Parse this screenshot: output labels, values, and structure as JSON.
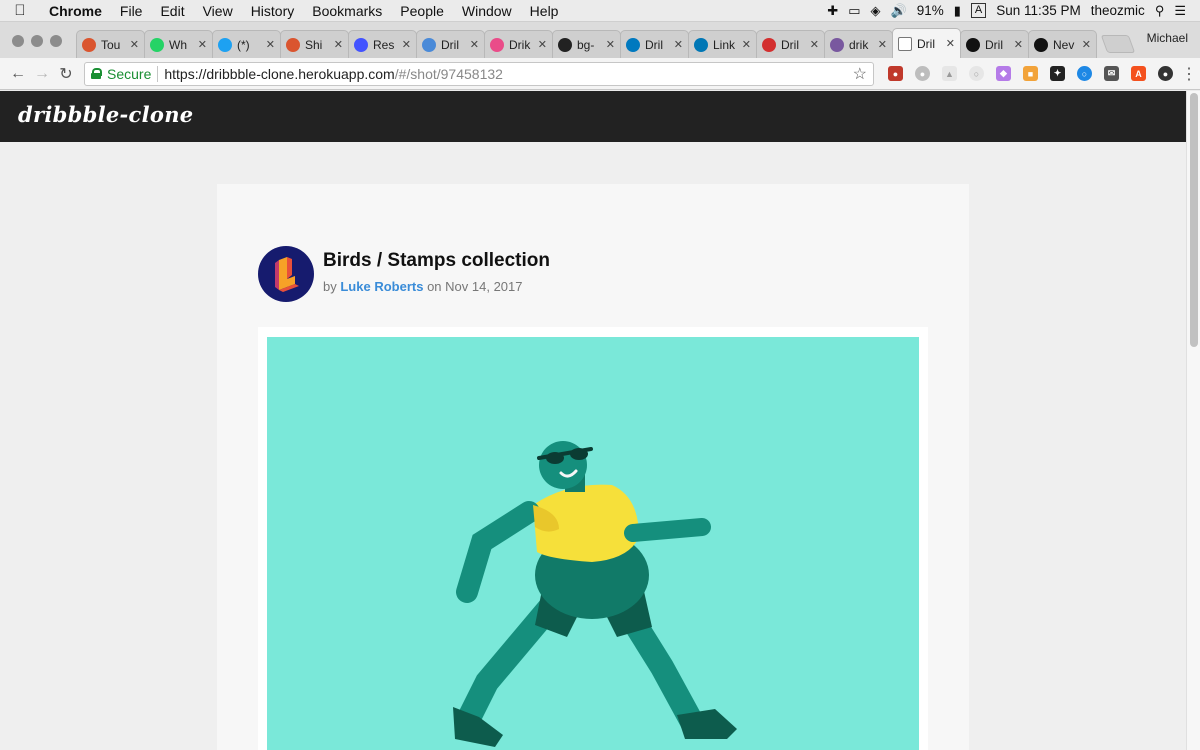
{
  "menubar": {
    "app": "Chrome",
    "items": [
      "File",
      "Edit",
      "View",
      "History",
      "Bookmarks",
      "People",
      "Window",
      "Help"
    ],
    "battery": "91%",
    "input_source": "A",
    "clock": "Sun 11:35 PM",
    "user": "theozmic"
  },
  "tabs": [
    {
      "label": "Tou",
      "icon": "product-hunt-icon",
      "color": "#da552f"
    },
    {
      "label": "Wh",
      "icon": "whatsapp-icon",
      "color": "#25d366"
    },
    {
      "label": "(*)",
      "icon": "twitter-icon",
      "color": "#1da1f2"
    },
    {
      "label": "Shi",
      "icon": "product-hunt-icon",
      "color": "#da552f"
    },
    {
      "label": "Res",
      "icon": "webflow-icon",
      "color": "#4353ff"
    },
    {
      "label": "Dril",
      "icon": "chart-icon",
      "color": "#4a8ad8"
    },
    {
      "label": "Drik",
      "icon": "dribbble-icon",
      "color": "#ea4c89"
    },
    {
      "label": "bg-",
      "icon": "github-icon",
      "color": "#222222"
    },
    {
      "label": "Dril",
      "icon": "trello-icon",
      "color": "#0079bf"
    },
    {
      "label": "Link",
      "icon": "linkedin-icon",
      "color": "#0077b5"
    },
    {
      "label": "Dril",
      "icon": "red-bars-icon",
      "color": "#d32f2f"
    },
    {
      "label": "drik",
      "icon": "heroku-icon",
      "color": "#79589f"
    },
    {
      "label": "Dril",
      "icon": "document-icon",
      "color": "#ffffff"
    },
    {
      "label": "Dril",
      "icon": "medium-icon",
      "color": "#111111"
    },
    {
      "label": "Nev",
      "icon": "medium-icon",
      "color": "#111111"
    }
  ],
  "active_tab_index": 12,
  "profile_name": "Michael",
  "toolbar": {
    "secure_label": "Secure",
    "url_host": "https://dribbble-clone.herokuapp.com",
    "url_path": "/#/shot/97458132"
  },
  "site": {
    "logo": "dribbble-clone"
  },
  "shot": {
    "title": "Birds / Stamps collection",
    "by_label": "by",
    "author": "Luke Roberts",
    "on_label": "on",
    "date": "Nov 14, 2017",
    "image_bg": "#7ae8d9"
  },
  "colors": {
    "header_bg": "#222222",
    "link": "#3a8cd8",
    "secure_green": "#1a8f33"
  }
}
